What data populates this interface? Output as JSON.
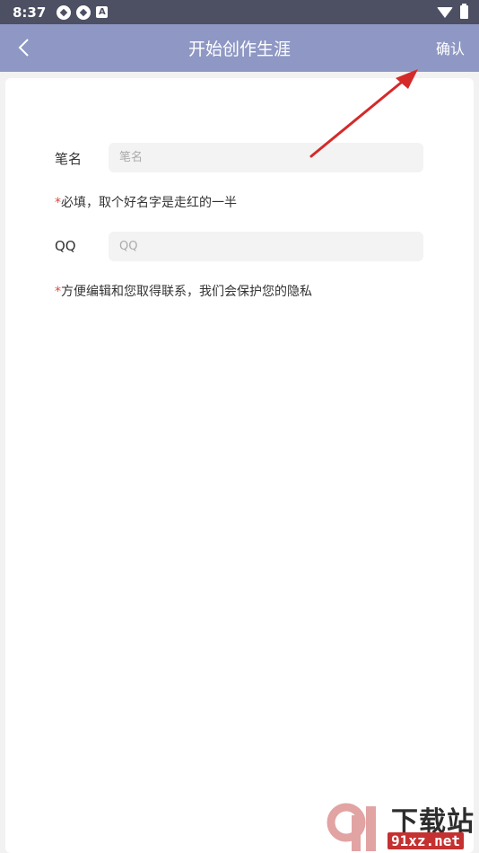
{
  "status_bar": {
    "time": "8:37",
    "left_icons": [
      "app-icon",
      "app-icon",
      "a-icon"
    ],
    "a_icon_letter": "A",
    "right_icons": [
      "wifi-icon",
      "battery-icon"
    ]
  },
  "nav": {
    "title": "开始创作生涯",
    "confirm_label": "确认",
    "back_icon": "chevron-left-icon"
  },
  "form": {
    "pen_name": {
      "label": "笔名",
      "placeholder": "笔名",
      "value": ""
    },
    "pen_name_hint": {
      "star": "*",
      "text": "必填，取个好名字是走红的一半"
    },
    "qq": {
      "label": "QQ",
      "placeholder": "QQ",
      "value": ""
    },
    "qq_hint": {
      "star": "*",
      "text": "方便编辑和您取得联系，我们会保护您的隐私"
    }
  },
  "watermark": {
    "title": "下载站",
    "site": "91xz.net"
  },
  "colors": {
    "status_bar": "#4d4f63",
    "nav_bar": "#8f98c4",
    "hint_star": "#e0463c",
    "annotation_arrow": "#d42a2a"
  }
}
